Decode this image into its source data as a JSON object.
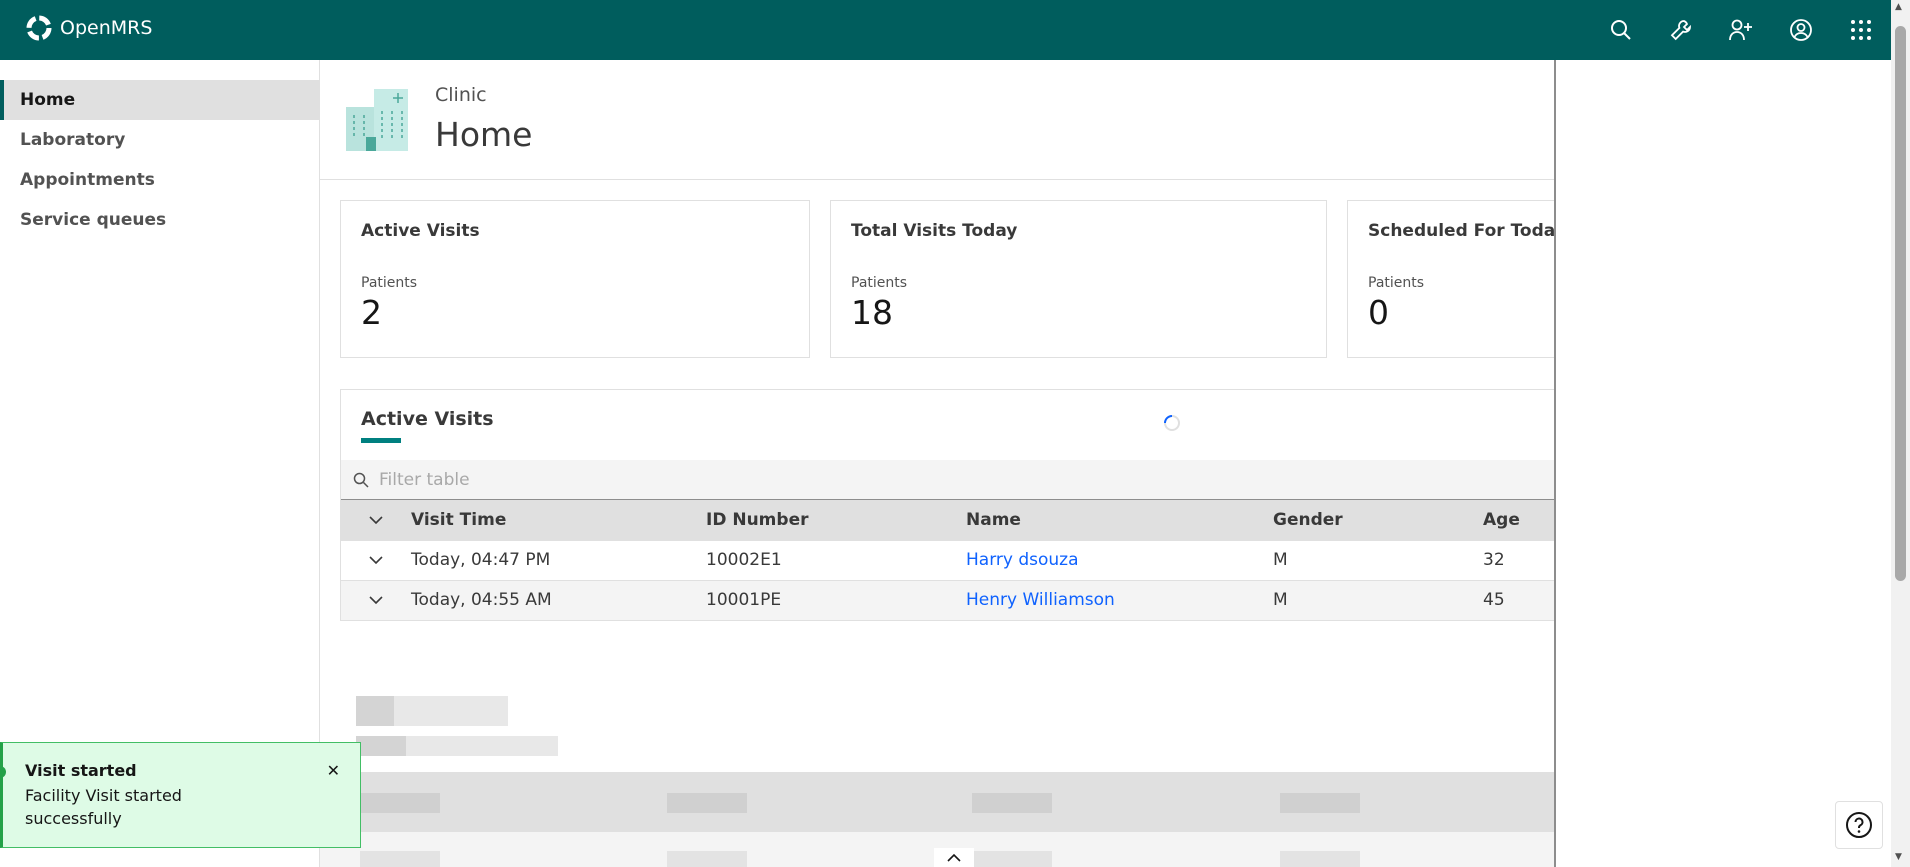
{
  "app": {
    "name": "OpenMRS"
  },
  "header_icons": [
    "search-icon",
    "wrench-icon",
    "add-patient-icon",
    "user-avatar-icon",
    "app-switcher-icon"
  ],
  "sidebar": {
    "items": [
      {
        "label": "Home",
        "active": true
      },
      {
        "label": "Laboratory"
      },
      {
        "label": "Appointments"
      },
      {
        "label": "Service queues"
      }
    ]
  },
  "page": {
    "subtitle": "Clinic",
    "title": "Home"
  },
  "tiles": [
    {
      "title": "Active Visits",
      "label": "Patients",
      "value": "2"
    },
    {
      "title": "Total Visits Today",
      "label": "Patients",
      "value": "18"
    },
    {
      "title": "Scheduled For Today",
      "label": "Patients",
      "value": "0"
    }
  ],
  "active_visits": {
    "title": "Active Visits",
    "filter_placeholder": "Filter table",
    "columns": [
      "Visit Time",
      "ID Number",
      "Name",
      "Gender",
      "Age"
    ],
    "rows": [
      {
        "time": "Today, 04:47 PM",
        "id": "10002E1",
        "name": "Harry dsouza",
        "gender": "M",
        "age": "32"
      },
      {
        "time": "Today, 04:55 AM",
        "id": "10001PE",
        "name": "Henry Williamson",
        "gender": "M",
        "age": "45"
      }
    ]
  },
  "toast": {
    "title": "Visit started",
    "message": "Facility Visit started successfully"
  },
  "colors": {
    "brand": "#005d5d",
    "accent": "#008080",
    "link": "#0f62fe",
    "success": "#24a148"
  }
}
